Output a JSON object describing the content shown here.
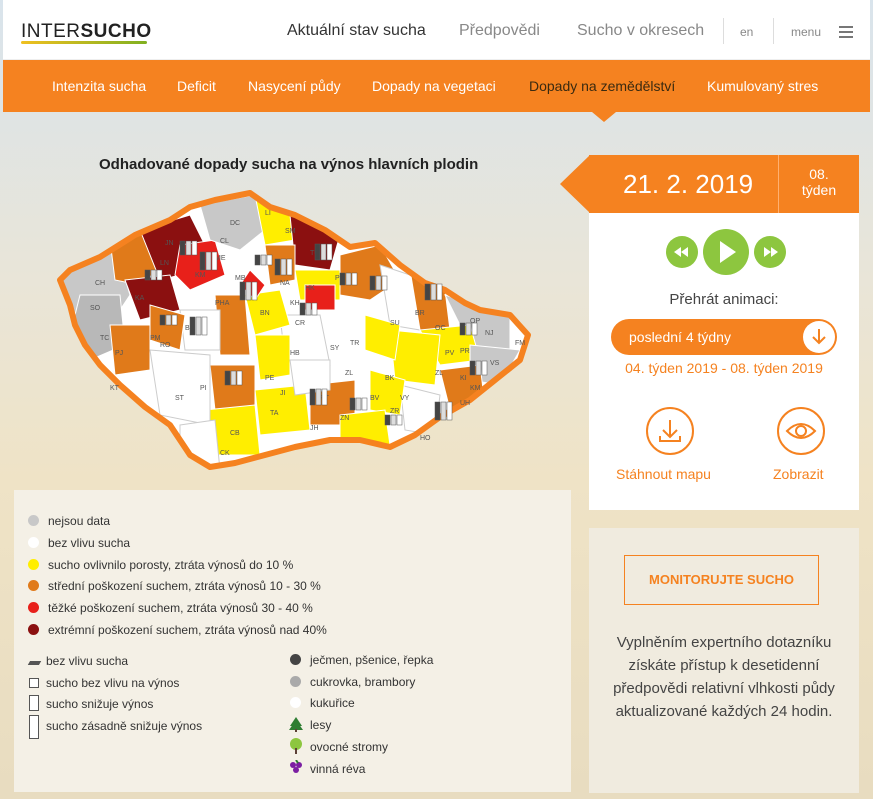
{
  "header": {
    "logo_light": "INTER",
    "logo_bold": "SUCHO",
    "nav": [
      "Aktuální stav sucha",
      "Předpovědi",
      "Sucho v okresech"
    ],
    "lang": "en",
    "menu": "menu"
  },
  "subnav": [
    "Intenzita sucha",
    "Deficit",
    "Nasycení půdy",
    "Dopady na vegetaci",
    "Dopady na zemědělství",
    "Kumulovaný stres"
  ],
  "map": {
    "title": "Odhadované dopady sucha na výnos hlavních plodin",
    "colors": {
      "nodata": "#c8c8c8",
      "none": "#ffffff",
      "low": "#ffee00",
      "medium": "#e07a1a",
      "severe": "#e8201a",
      "extreme": "#8b1010",
      "border": "#f58220"
    },
    "district_labels": [
      "LI",
      "DC",
      "SM",
      "CL",
      "JN",
      "TU",
      "MB",
      "NA",
      "KM",
      "LN",
      "ME",
      "HK",
      "CH",
      "SO",
      "PHA",
      "KH",
      "PU",
      "SU",
      "OP",
      "BR",
      "KA",
      "TC",
      "PM",
      "PJ",
      "RO",
      "BE",
      "BN",
      "CR",
      "SY",
      "KT",
      "PI",
      "ST",
      "PE",
      "JI",
      "HB",
      "TR",
      "BK",
      "VY",
      "PV",
      "PR",
      "KM",
      "ZL",
      "VS",
      "FM",
      "NJ",
      "ZR",
      "HO",
      "UH",
      "ZN",
      "BV",
      "PT",
      "CB",
      "CK",
      "JH",
      "TA",
      "ZL",
      "OC",
      "KI"
    ]
  },
  "date": {
    "date": "21. 2. 2019",
    "week_line1": "08.",
    "week_line2": "týden"
  },
  "player": {
    "label": "Přehrát animaci:",
    "select_value": "poslední 4 týdny",
    "range": "04. týden 2019 - 08. týden 2019",
    "download": "Stáhnout mapu",
    "view": "Zobrazit"
  },
  "legend": {
    "colors": [
      {
        "label": "nejsou data",
        "color": "#c8c8c8"
      },
      {
        "label": "bez vlivu sucha",
        "color": "#ffffff"
      },
      {
        "label": "sucho ovlivnilo porosty, ztráta výnosů do 10 %",
        "color": "#ffee00"
      },
      {
        "label": "střední poškození suchem, ztráta výnosů 10 - 30 %",
        "color": "#e07a1a"
      },
      {
        "label": "těžké poškození suchem, ztráta výnosů 30 - 40 %",
        "color": "#e8201a"
      },
      {
        "label": "extrémní poškození suchem, ztráta výnosů nad 40%",
        "color": "#8b1010"
      }
    ],
    "bars": [
      "bez vlivu sucha",
      "sucho bez vlivu na výnos",
      "sucho snižuje výnos",
      "sucho zásadně snižuje výnos"
    ],
    "crops": [
      {
        "label": "ječmen, pšenice, řepka",
        "color": "#444444"
      },
      {
        "label": "cukrovka, brambory",
        "color": "#aaaaaa"
      },
      {
        "label": "kukuřice",
        "color": "#ffffff"
      }
    ],
    "symbols": [
      {
        "label": "lesy",
        "icon": "tree-icon"
      },
      {
        "label": "ovocné stromy",
        "icon": "fruit-tree-icon"
      },
      {
        "label": "vinná réva",
        "icon": "grapes-icon"
      }
    ]
  },
  "monitor": {
    "button": "MONITORUJTE SUCHO",
    "text": "Vyplněním expertního dotazníku získáte přístup k desetidenní předpovědi relativní vlhkosti půdy aktualizované každých 24 hodin."
  }
}
